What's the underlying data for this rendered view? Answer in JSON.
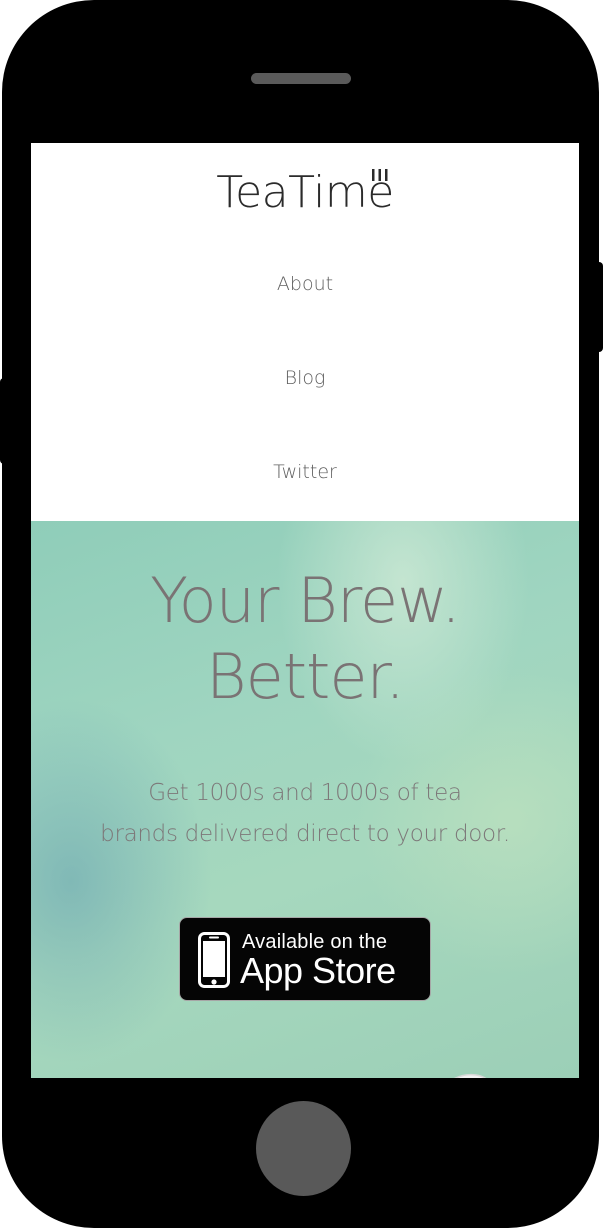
{
  "site": {
    "logo_text": "TeaTime"
  },
  "nav": {
    "items": [
      {
        "label": "About"
      },
      {
        "label": "Blog"
      },
      {
        "label": "Twitter"
      }
    ]
  },
  "hero": {
    "title_line1": "Your Brew.",
    "title_line2": "Better.",
    "subtitle_line1": "Get 1000s and 1000s of tea",
    "subtitle_line2": "brands delivered direct to your door."
  },
  "app_store_badge": {
    "line1": "Available on the",
    "line2": "App Store",
    "icon": "iphone-icon"
  },
  "colors": {
    "phone_body": "#000000",
    "hero_accent": "#9fd5c0",
    "text_muted": "#7a7374",
    "nav_text": "#5f5f5f"
  }
}
